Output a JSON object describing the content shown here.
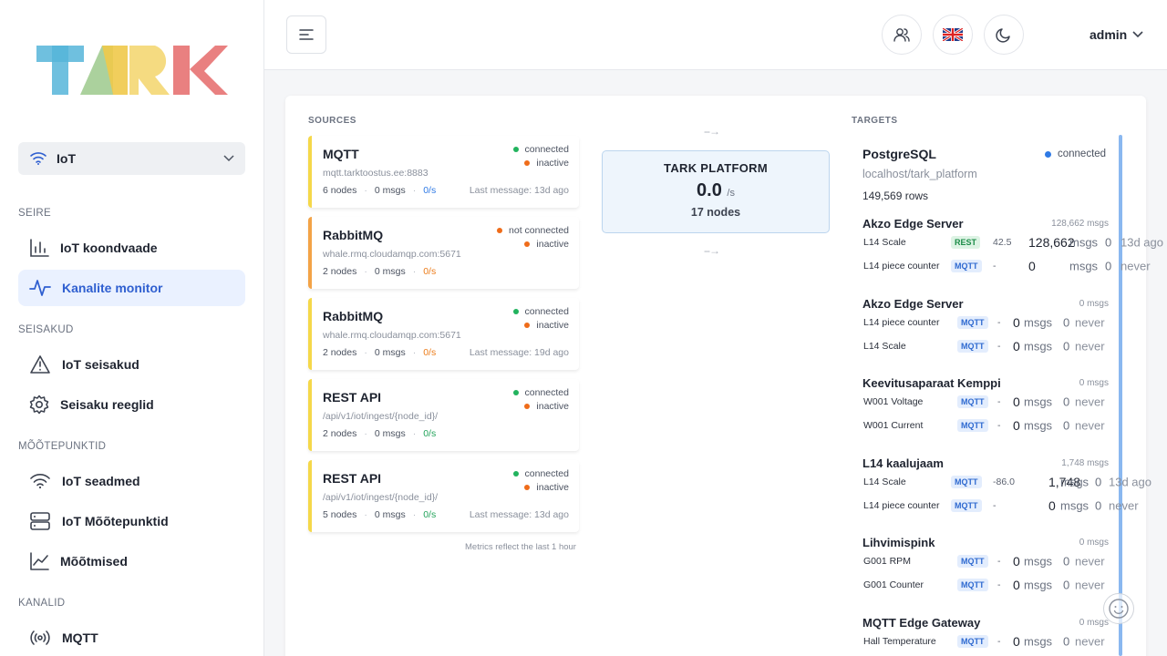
{
  "app": {
    "logo_text": "TARK"
  },
  "sidebar": {
    "context": {
      "label": "IoT"
    },
    "sections": [
      {
        "title": "SEIRE"
      },
      {
        "title": "SEISAKUD"
      },
      {
        "title": "MÕÕTEPUNKTID"
      },
      {
        "title": "KANALID"
      }
    ],
    "items": [
      {
        "label": "IoT koondvaade",
        "icon": "bar-chart-icon"
      },
      {
        "label": "Kanalite monitor",
        "icon": "activity-icon",
        "active": true
      },
      {
        "label": "IoT seisakud",
        "icon": "warning-icon"
      },
      {
        "label": "Seisaku reeglid",
        "icon": "gear-icon"
      },
      {
        "label": "IoT seadmed",
        "icon": "wifi-icon"
      },
      {
        "label": "IoT Mõõtepunktid",
        "icon": "server-icon"
      },
      {
        "label": "Mõõtmised",
        "icon": "line-chart-icon"
      },
      {
        "label": "MQTT",
        "icon": "broadcast-icon"
      }
    ]
  },
  "header": {
    "user": "admin"
  },
  "monitor": {
    "sources_title": "SOURCES",
    "targets_title": "TARGETS",
    "sources": [
      {
        "name": "MQTT",
        "url": "mqtt.tarktoostus.ee:8883",
        "nodes": "6 nodes",
        "msgs": "0 msgs",
        "rate": "0/s",
        "rate_color": "blue",
        "status1": "connected",
        "status1_color": "green",
        "status2": "inactive",
        "last": "Last message: 13d ago"
      },
      {
        "name": "RabbitMQ",
        "url": "whale.rmq.cloudamqp.com:5671",
        "nodes": "2 nodes",
        "msgs": "0 msgs",
        "rate": "0/s",
        "rate_color": "orange",
        "status1": "not connected",
        "status1_color": "orange",
        "status2": "inactive",
        "last": ""
      },
      {
        "name": "RabbitMQ",
        "url": "whale.rmq.cloudamqp.com:5671",
        "nodes": "2 nodes",
        "msgs": "0 msgs",
        "rate": "0/s",
        "rate_color": "orange",
        "status1": "connected",
        "status1_color": "green",
        "status2": "inactive",
        "last": "Last message: 19d ago"
      },
      {
        "name": "REST API",
        "url": "/api/v1/iot/ingest/{node_id}/",
        "nodes": "2 nodes",
        "msgs": "0 msgs",
        "rate": "0/s",
        "rate_color": "green",
        "status1": "connected",
        "status1_color": "green",
        "status2": "inactive",
        "last": ""
      },
      {
        "name": "REST API",
        "url": "/api/v1/iot/ingest/{node_id}/",
        "nodes": "5 nodes",
        "msgs": "0 msgs",
        "rate": "0/s",
        "rate_color": "green",
        "status1": "connected",
        "status1_color": "green",
        "status2": "inactive",
        "last": "Last message: 13d ago"
      }
    ],
    "footnote": "Metrics reflect the last 1 hour",
    "platform": {
      "title": "TARK PLATFORM",
      "rate": "0.0",
      "rate_unit": "/s",
      "nodes": "17 nodes"
    },
    "target": {
      "name": "PostgreSQL",
      "status": "connected",
      "host": "localhost/tark_platform",
      "rows": "149,569 rows"
    },
    "groups": [
      {
        "name": "Akzo Edge Server",
        "count": "128,662 msgs",
        "rows": [
          {
            "name": "L14 Scale",
            "type": "REST",
            "value": "42.5",
            "msgs": "128,662",
            "errors": "0",
            "last": "13d ago"
          },
          {
            "name": "L14 piece counter",
            "type": "MQTT",
            "value": "-",
            "msgs": "0",
            "errors": "0",
            "last": "never"
          }
        ]
      },
      {
        "name": "Akzo Edge Server",
        "count": "0 msgs",
        "rows": [
          {
            "name": "L14 piece counter",
            "type": "MQTT",
            "value": "-",
            "msgs": "0",
            "errors": "0",
            "last": "never"
          },
          {
            "name": "L14 Scale",
            "type": "MQTT",
            "value": "-",
            "msgs": "0",
            "errors": "0",
            "last": "never"
          }
        ]
      },
      {
        "name": "Keevitusaparaat Kemppi",
        "count": "0 msgs",
        "rows": [
          {
            "name": "W001 Voltage",
            "type": "MQTT",
            "value": "-",
            "msgs": "0",
            "errors": "0",
            "last": "never"
          },
          {
            "name": "W001 Current",
            "type": "MQTT",
            "value": "-",
            "msgs": "0",
            "errors": "0",
            "last": "never"
          }
        ]
      },
      {
        "name": "L14 kaalujaam",
        "count": "1,748 msgs",
        "rows": [
          {
            "name": "L14 Scale",
            "type": "MQTT",
            "value": "-86.0",
            "msgs": "1,748",
            "errors": "0",
            "last": "13d ago"
          },
          {
            "name": "L14 piece counter",
            "type": "MQTT",
            "value": "-",
            "msgs": "0",
            "errors": "0",
            "last": "never"
          }
        ]
      },
      {
        "name": "Lihvimispink",
        "count": "0 msgs",
        "rows": [
          {
            "name": "G001 RPM",
            "type": "MQTT",
            "value": "-",
            "msgs": "0",
            "errors": "0",
            "last": "never"
          },
          {
            "name": "G001 Counter",
            "type": "MQTT",
            "value": "-",
            "msgs": "0",
            "errors": "0",
            "last": "never"
          }
        ]
      },
      {
        "name": "MQTT Edge Gateway",
        "count": "0 msgs",
        "rows": [
          {
            "name": "Hall Temperature",
            "type": "MQTT",
            "value": "-",
            "msgs": "0",
            "errors": "0",
            "last": "never"
          }
        ]
      }
    ],
    "msgs_unit": "msgs"
  }
}
